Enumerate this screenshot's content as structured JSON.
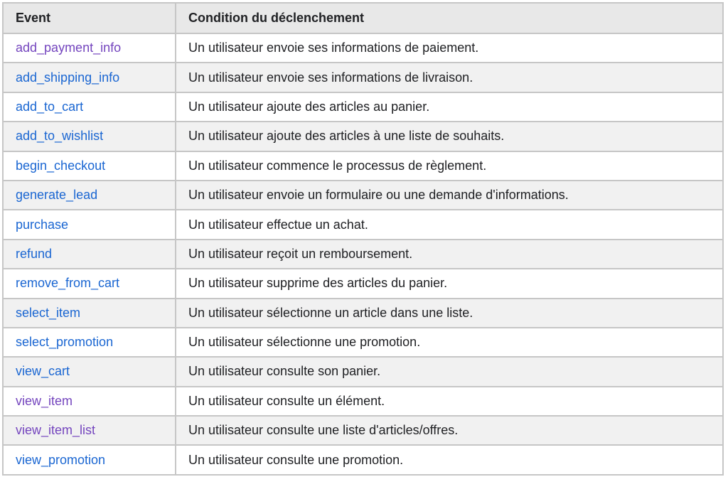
{
  "table": {
    "headers": {
      "event": "Event",
      "condition": "Condition du déclenchement"
    },
    "colors": {
      "link": "#1a66d2",
      "visited_link": "#7445be",
      "header_bg": "#e8e8e8",
      "stripe_bg": "#f1f1f1",
      "border": "#c6c6c6",
      "text": "#202124"
    },
    "rows": [
      {
        "event": "add_payment_info",
        "visited": true,
        "condition": "Un utilisateur envoie ses informations de paiement."
      },
      {
        "event": "add_shipping_info",
        "visited": false,
        "condition": "Un utilisateur envoie ses informations de livraison."
      },
      {
        "event": "add_to_cart",
        "visited": false,
        "condition": "Un utilisateur ajoute des articles au panier."
      },
      {
        "event": "add_to_wishlist",
        "visited": false,
        "condition": "Un utilisateur ajoute des articles à une liste de souhaits."
      },
      {
        "event": "begin_checkout",
        "visited": false,
        "condition": "Un utilisateur commence le processus de règlement."
      },
      {
        "event": "generate_lead",
        "visited": false,
        "condition": "Un utilisateur envoie un formulaire ou une demande d'informations."
      },
      {
        "event": "purchase",
        "visited": false,
        "condition": "Un utilisateur effectue un achat."
      },
      {
        "event": "refund",
        "visited": false,
        "condition": "Un utilisateur reçoit un remboursement."
      },
      {
        "event": "remove_from_cart",
        "visited": false,
        "condition": "Un utilisateur supprime des articles du panier."
      },
      {
        "event": "select_item",
        "visited": false,
        "condition": "Un utilisateur sélectionne un article dans une liste."
      },
      {
        "event": "select_promotion",
        "visited": false,
        "condition": "Un utilisateur sélectionne une promotion."
      },
      {
        "event": "view_cart",
        "visited": false,
        "condition": "Un utilisateur consulte son panier."
      },
      {
        "event": "view_item",
        "visited": true,
        "condition": "Un utilisateur consulte un élément."
      },
      {
        "event": "view_item_list",
        "visited": true,
        "condition": "Un utilisateur consulte une liste d'articles/offres."
      },
      {
        "event": "view_promotion",
        "visited": false,
        "condition": "Un utilisateur consulte une promotion."
      }
    ]
  }
}
